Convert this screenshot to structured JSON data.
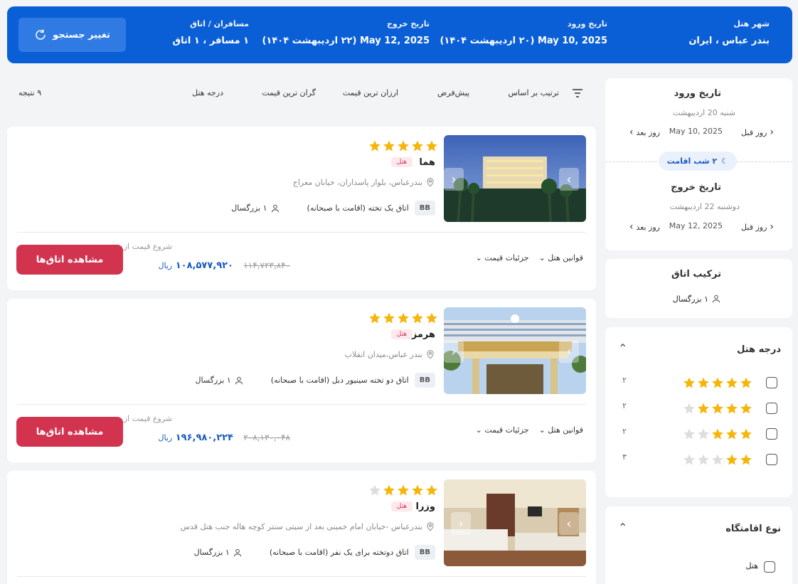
{
  "search": {
    "city_label": "شهر هتل",
    "city_value": "بندر عباس ، ایران",
    "checkin_label": "تاریخ ورود",
    "checkin_value": "May 10, 2025 (۲۰ اردیبهشت ۱۴۰۴)",
    "checkout_label": "تاریخ خروج",
    "checkout_value": "May 12, 2025 (۲۲ اردیبهشت ۱۴۰۴)",
    "guests_label": "مسافران / اتاق",
    "guests_value": "۱ مسافر ، ۱ اتاق",
    "change_button": "تغییر جستجو"
  },
  "sidebar": {
    "checkin_title": "تاریخ ورود",
    "checkin_sub": "شنبه 20 اردیبهشت",
    "checkin_date": "May 10, 2025",
    "prev_day": "روز قبل",
    "next_day": "روز بعد",
    "nights": "۲ شب اقامت",
    "checkout_title": "تاریخ خروج",
    "checkout_sub": "دوشنبه 22 اردیبهشت",
    "checkout_date": "May 12, 2025",
    "room_title": "ترکیب اتاق",
    "room_value": "۱ بزرگسال",
    "rating_title": "درجه هتل",
    "rating_rows": [
      {
        "stars": 5,
        "count": "۲"
      },
      {
        "stars": 4,
        "count": "۲"
      },
      {
        "stars": 3,
        "count": "۲"
      },
      {
        "stars": 2,
        "count": "۳"
      }
    ],
    "type_title": "نوع اقامتگاه",
    "type_option": "هتل"
  },
  "sort": {
    "label": "ترتیب بر اساس",
    "options": [
      "پیش‌فرض",
      "ارزان ترین قیمت",
      "گران ترین قیمت",
      "درجه هتل"
    ],
    "results": "۹ نتیجه"
  },
  "hotels": [
    {
      "name": "هما",
      "type": "هتل",
      "stars": 5,
      "address": "بندرعباس، بلوار پاسداران، خیابان معراج",
      "board": "BB",
      "room": "اتاق یک تخته (اقامت با صبحانه)",
      "guests": "۱ بزرگسال",
      "rules": "قوانین هتل",
      "price_details": "جزئیات قیمت",
      "from": "شروع قیمت از",
      "old_price": "۱۱۴,۷۲۳,۸۴۰",
      "price": "۱۰۸,۵۷۷,۹۲۰",
      "currency": "ریال",
      "button": "مشاهده اتاق‌ها"
    },
    {
      "name": "هرمز",
      "type": "هتل",
      "stars": 5,
      "address": "بندر عباس،میدان انقلاب",
      "board": "BB",
      "room": "اتاق دو تخته سینیور دبل (اقامت با صبحانه)",
      "guests": "۱ بزرگسال",
      "rules": "قوانین هتل",
      "price_details": "جزئیات قیمت",
      "from": "شروع قیمت از",
      "old_price": "۲۰۸,۱۳۰,۰۴۸",
      "price": "۱۹۶,۹۸۰,۲۲۴",
      "currency": "ریال",
      "button": "مشاهده اتاق‌ها"
    },
    {
      "name": "وزرا",
      "type": "هتل",
      "stars": 4,
      "address": "بندرعباس -خیابان امام خمینی بعد از سیتی سنتر کوچه هاله جنب هتل قدس",
      "board": "BB",
      "room": "اتاق دوتخته برای یک نفر (اقامت با صبحانه)",
      "guests": "۱ بزرگسال"
    }
  ],
  "colors": {
    "primary": "#0b5fd6",
    "accent": "#d2334f",
    "star": "#f5b50a",
    "star_empty": "#dddddd"
  }
}
